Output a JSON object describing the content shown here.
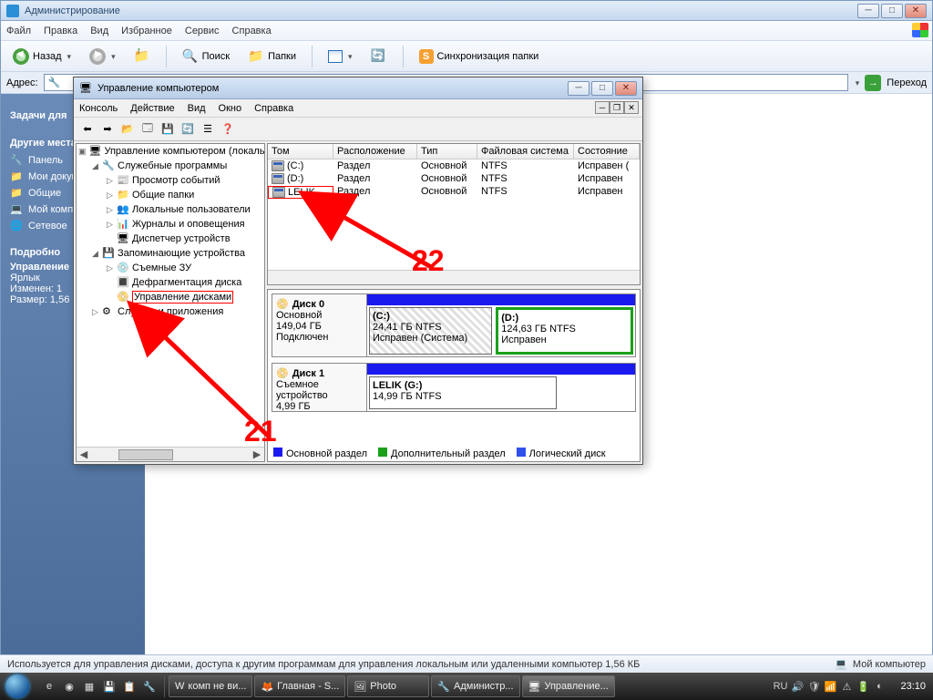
{
  "parent_window": {
    "title": "Администрирование",
    "menu": [
      "Файл",
      "Правка",
      "Вид",
      "Избранное",
      "Сервис",
      "Справка"
    ],
    "toolbar": {
      "back": "Назад",
      "search": "Поиск",
      "folders": "Папки",
      "sync": "Синхронизация папки"
    },
    "address_label": "Адрес:",
    "go": "Переход"
  },
  "sidebar": {
    "tasks_header": "Задачи для",
    "places_header": "Другие места",
    "places": [
      "Панель",
      "Мои документы",
      "Общие",
      "Мой компьютер",
      "Сетевое"
    ],
    "details_header": "Подробно",
    "details_name": "Управление",
    "details_type": "Ярлык",
    "details_modified": "Изменен: 1",
    "details_size": "Размер: 1,56"
  },
  "mmc": {
    "title": "Управление компьютером",
    "menu": [
      "Консоль",
      "Действие",
      "Вид",
      "Окно",
      "Справка"
    ],
    "tree": {
      "root": "Управление компьютером (локальный)",
      "g1": "Служебные программы",
      "g1_items": [
        "Просмотр событий",
        "Общие папки",
        "Локальные пользователи",
        "Журналы и оповещения",
        "Диспетчер устройств"
      ],
      "g2": "Запоминающие устройства",
      "g2_items": [
        "Съемные ЗУ",
        "Дефрагментация диска",
        "Управление дисками"
      ],
      "g3": "Службы и приложения"
    },
    "columns": [
      "Том",
      "Расположение",
      "Тип",
      "Файловая система",
      "Состояние"
    ],
    "volumes": [
      {
        "name": "(C:)",
        "layout": "Раздел",
        "type": "Основной",
        "fs": "NTFS",
        "state": "Исправен ("
      },
      {
        "name": "(D:)",
        "layout": "Раздел",
        "type": "Основной",
        "fs": "NTFS",
        "state": "Исправен"
      },
      {
        "name": "LELIK",
        "layout": "Раздел",
        "type": "Основной",
        "fs": "NTFS",
        "state": "Исправен"
      }
    ],
    "disk0": {
      "title": "Диск 0",
      "type": "Основной",
      "size": "149,04 ГБ",
      "status": "Подключен",
      "p1": {
        "name": "(C:)",
        "info": "24,41 ГБ NTFS",
        "state": "Исправен (Система)"
      },
      "p2": {
        "name": "(D:)",
        "info": "124,63 ГБ NTFS",
        "state": "Исправен"
      }
    },
    "disk1": {
      "title": "Диск 1",
      "type": "Съемное устройство",
      "size": "4,99 ГБ",
      "p1": {
        "name": "LELIK  (G:)",
        "info": "14,99 ГБ NTFS"
      }
    },
    "legend": [
      "Основной раздел",
      "Дополнительный раздел",
      "Логический диск"
    ]
  },
  "annot": {
    "n21": "21",
    "n22": "22"
  },
  "status": {
    "text": "Используется для управления дисками, доступа к другим программам для управления локальным или удаленными компьютер 1,56 КБ",
    "right": "Мой компьютер"
  },
  "taskbar": {
    "tasks": [
      "комп не ви...",
      "Главная - S...",
      "Photo",
      "Администр...",
      "Управление..."
    ],
    "lang": "RU",
    "time": "23:10"
  }
}
